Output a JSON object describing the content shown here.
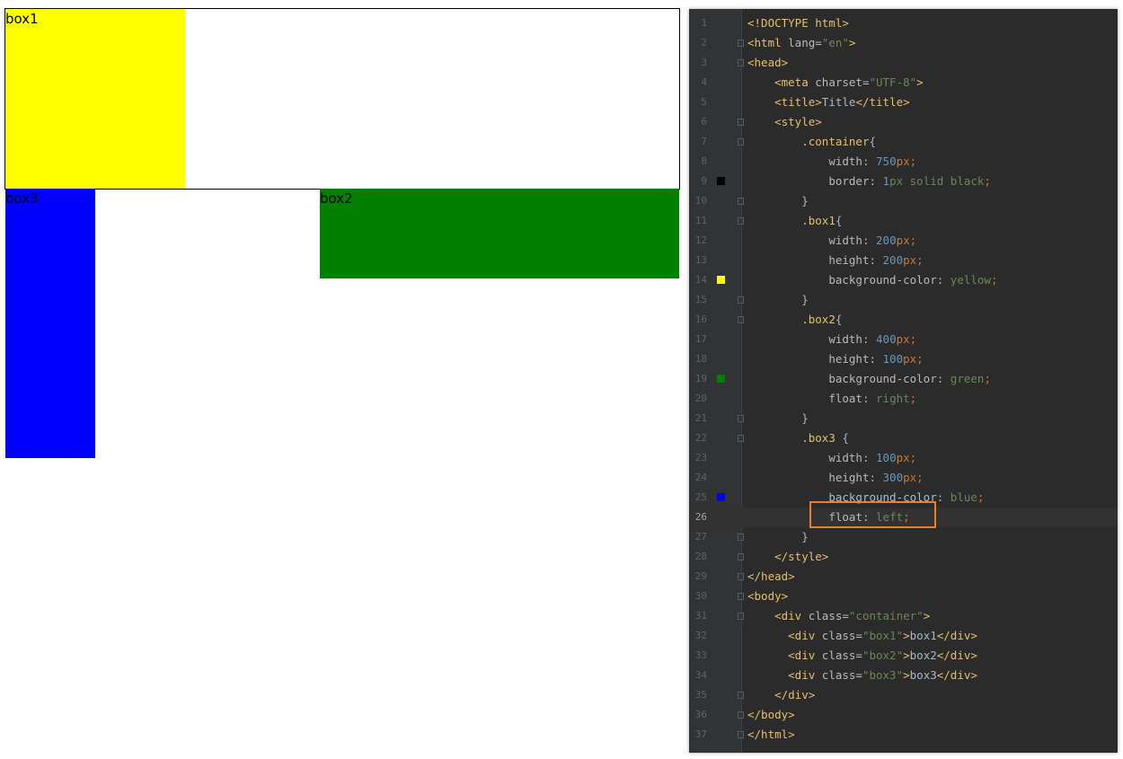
{
  "preview": {
    "box1_label": "box1",
    "box2_label": "box2",
    "box3_label": "box3",
    "colors": {
      "box1": "#ffff00",
      "box2": "#008000",
      "box3": "#0000ff",
      "border": "#000000"
    }
  },
  "editor": {
    "current_line": 26,
    "lines": [
      {
        "n": "1",
        "tokens": [
          [
            "doctype",
            "<!DOCTYPE html>"
          ]
        ]
      },
      {
        "n": "2",
        "tokens": [
          [
            "tag",
            "<html "
          ],
          [
            "attr",
            "lang="
          ],
          [
            "str",
            "\"en\""
          ],
          [
            "tag",
            ">"
          ]
        ]
      },
      {
        "n": "3",
        "tokens": [
          [
            "tag",
            "<head>"
          ]
        ]
      },
      {
        "n": "4",
        "tokens": [
          [
            "txt",
            "    "
          ],
          [
            "tag",
            "<meta "
          ],
          [
            "attr",
            "charset="
          ],
          [
            "str",
            "\"UTF-8\""
          ],
          [
            "tag",
            ">"
          ]
        ]
      },
      {
        "n": "5",
        "tokens": [
          [
            "txt",
            "    "
          ],
          [
            "tag",
            "<title>"
          ],
          [
            "txt",
            "Title"
          ],
          [
            "tag",
            "</title>"
          ]
        ]
      },
      {
        "n": "6",
        "tokens": [
          [
            "txt",
            "    "
          ],
          [
            "tag",
            "<style>"
          ]
        ]
      },
      {
        "n": "7",
        "tokens": [
          [
            "txt",
            "        "
          ],
          [
            "sel",
            ".container"
          ],
          [
            "txt",
            "{"
          ]
        ]
      },
      {
        "n": "8",
        "tokens": [
          [
            "txt",
            "            "
          ],
          [
            "prop",
            "width"
          ],
          [
            "txt",
            ": "
          ],
          [
            "num",
            "750"
          ],
          [
            "punc",
            "px;"
          ]
        ]
      },
      {
        "n": "9",
        "tokens": [
          [
            "txt",
            "            "
          ],
          [
            "prop",
            "border"
          ],
          [
            "txt",
            ": "
          ],
          [
            "num",
            "1"
          ],
          [
            "val",
            "px solid black"
          ],
          [
            "punc",
            ";"
          ]
        ]
      },
      {
        "n": "10",
        "tokens": [
          [
            "txt",
            "        }"
          ]
        ]
      },
      {
        "n": "11",
        "tokens": [
          [
            "txt",
            "        "
          ],
          [
            "sel",
            ".box1"
          ],
          [
            "txt",
            "{"
          ]
        ]
      },
      {
        "n": "12",
        "tokens": [
          [
            "txt",
            "            "
          ],
          [
            "prop",
            "width"
          ],
          [
            "txt",
            ": "
          ],
          [
            "num",
            "200"
          ],
          [
            "punc",
            "px;"
          ]
        ]
      },
      {
        "n": "13",
        "tokens": [
          [
            "txt",
            "            "
          ],
          [
            "prop",
            "height"
          ],
          [
            "txt",
            ": "
          ],
          [
            "num",
            "200"
          ],
          [
            "punc",
            "px;"
          ]
        ]
      },
      {
        "n": "14",
        "tokens": [
          [
            "txt",
            "            "
          ],
          [
            "prop",
            "background-color"
          ],
          [
            "txt",
            ": "
          ],
          [
            "val",
            "yellow"
          ],
          [
            "punc",
            ";"
          ]
        ]
      },
      {
        "n": "15",
        "tokens": [
          [
            "txt",
            "        }"
          ]
        ]
      },
      {
        "n": "16",
        "tokens": [
          [
            "txt",
            "        "
          ],
          [
            "sel",
            ".box2"
          ],
          [
            "txt",
            "{"
          ]
        ]
      },
      {
        "n": "17",
        "tokens": [
          [
            "txt",
            "            "
          ],
          [
            "prop",
            "width"
          ],
          [
            "txt",
            ": "
          ],
          [
            "num",
            "400"
          ],
          [
            "punc",
            "px;"
          ]
        ]
      },
      {
        "n": "18",
        "tokens": [
          [
            "txt",
            "            "
          ],
          [
            "prop",
            "height"
          ],
          [
            "txt",
            ": "
          ],
          [
            "num",
            "100"
          ],
          [
            "punc",
            "px;"
          ]
        ]
      },
      {
        "n": "19",
        "tokens": [
          [
            "txt",
            "            "
          ],
          [
            "prop",
            "background-color"
          ],
          [
            "txt",
            ": "
          ],
          [
            "val",
            "green"
          ],
          [
            "punc",
            ";"
          ]
        ]
      },
      {
        "n": "20",
        "tokens": [
          [
            "txt",
            "            "
          ],
          [
            "prop",
            "float"
          ],
          [
            "txt",
            ": "
          ],
          [
            "val",
            "right"
          ],
          [
            "punc",
            ";"
          ]
        ]
      },
      {
        "n": "21",
        "tokens": [
          [
            "txt",
            "        }"
          ]
        ]
      },
      {
        "n": "22",
        "tokens": [
          [
            "txt",
            "        "
          ],
          [
            "sel",
            ".box3 "
          ],
          [
            "txt",
            "{"
          ]
        ]
      },
      {
        "n": "23",
        "tokens": [
          [
            "txt",
            "            "
          ],
          [
            "prop",
            "width"
          ],
          [
            "txt",
            ": "
          ],
          [
            "num",
            "100"
          ],
          [
            "punc",
            "px;"
          ]
        ]
      },
      {
        "n": "24",
        "tokens": [
          [
            "txt",
            "            "
          ],
          [
            "prop",
            "height"
          ],
          [
            "txt",
            ": "
          ],
          [
            "num",
            "300"
          ],
          [
            "punc",
            "px;"
          ]
        ]
      },
      {
        "n": "25",
        "tokens": [
          [
            "txt",
            "            "
          ],
          [
            "prop",
            "background-color"
          ],
          [
            "txt",
            ": "
          ],
          [
            "val",
            "blue"
          ],
          [
            "punc",
            ";"
          ]
        ]
      },
      {
        "n": "26",
        "tokens": [
          [
            "txt",
            "            "
          ],
          [
            "prop",
            "float"
          ],
          [
            "txt",
            ": "
          ],
          [
            "val",
            "left"
          ],
          [
            "punc",
            ";"
          ]
        ]
      },
      {
        "n": "27",
        "tokens": [
          [
            "txt",
            "        }"
          ]
        ]
      },
      {
        "n": "28",
        "tokens": [
          [
            "txt",
            "    "
          ],
          [
            "tag",
            "</style>"
          ]
        ]
      },
      {
        "n": "29",
        "tokens": [
          [
            "tag",
            "</head>"
          ]
        ]
      },
      {
        "n": "30",
        "tokens": [
          [
            "tag",
            "<body>"
          ]
        ]
      },
      {
        "n": "31",
        "tokens": [
          [
            "txt",
            "    "
          ],
          [
            "tag",
            "<div "
          ],
          [
            "attr",
            "class="
          ],
          [
            "str",
            "\"container\""
          ],
          [
            "tag",
            ">"
          ]
        ]
      },
      {
        "n": "32",
        "tokens": [
          [
            "txt",
            "      "
          ],
          [
            "tag",
            "<div "
          ],
          [
            "attr",
            "class="
          ],
          [
            "str",
            "\"box1\""
          ],
          [
            "tag",
            ">"
          ],
          [
            "txt",
            "box1"
          ],
          [
            "tag",
            "</div>"
          ]
        ]
      },
      {
        "n": "33",
        "tokens": [
          [
            "txt",
            "      "
          ],
          [
            "tag",
            "<div "
          ],
          [
            "attr",
            "class="
          ],
          [
            "str",
            "\"box2\""
          ],
          [
            "tag",
            ">"
          ],
          [
            "txt",
            "box2"
          ],
          [
            "tag",
            "</div>"
          ]
        ]
      },
      {
        "n": "34",
        "tokens": [
          [
            "txt",
            "      "
          ],
          [
            "tag",
            "<div "
          ],
          [
            "attr",
            "class="
          ],
          [
            "str",
            "\"box3\""
          ],
          [
            "tag",
            ">"
          ],
          [
            "txt",
            "box3"
          ],
          [
            "tag",
            "</div>"
          ]
        ]
      },
      {
        "n": "35",
        "tokens": [
          [
            "txt",
            "    "
          ],
          [
            "tag",
            "</div>"
          ]
        ]
      },
      {
        "n": "36",
        "tokens": [
          [
            "tag",
            "</body>"
          ]
        ]
      },
      {
        "n": "37",
        "tokens": [
          [
            "tag",
            "</html>"
          ]
        ]
      }
    ],
    "swatches": [
      {
        "line": 9,
        "color": "#000000"
      },
      {
        "line": 14,
        "color": "#ffff00"
      },
      {
        "line": 19,
        "color": "#008000"
      },
      {
        "line": 25,
        "color": "#0000ff"
      }
    ],
    "fold_lines": [
      2,
      3,
      6,
      7,
      10,
      11,
      15,
      16,
      21,
      22,
      27,
      28,
      29,
      30,
      31,
      35,
      36,
      37
    ]
  }
}
